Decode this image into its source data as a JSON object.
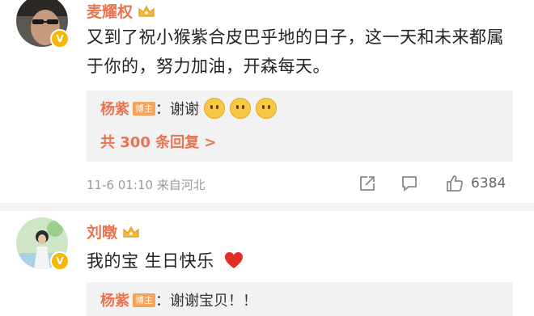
{
  "comments": [
    {
      "author": "麦耀权",
      "verified": "V",
      "text": "又到了祝小猴紫合皮巴乎地的日子，这一天和未来都属于你的，努力加油，开森每天。",
      "reply": {
        "author": "杨紫",
        "host_tag": "博主",
        "text": "：谢谢",
        "emoji": [
          "hug-emoji",
          "hug-emoji",
          "hug-emoji"
        ]
      },
      "more_replies": "共 300 条回复 >",
      "meta": "11-6 01:10  来自河北",
      "likes": "6384"
    },
    {
      "author": "刘暾",
      "verified": "V",
      "text": "我的宝 生日快乐",
      "reply": {
        "author": "杨紫",
        "host_tag": "博主",
        "text": "：谢谢宝贝！！"
      }
    }
  ],
  "colors": {
    "name": "#eb7350",
    "reply_bg": "#f2f2f2",
    "badge": "#f6b800"
  }
}
